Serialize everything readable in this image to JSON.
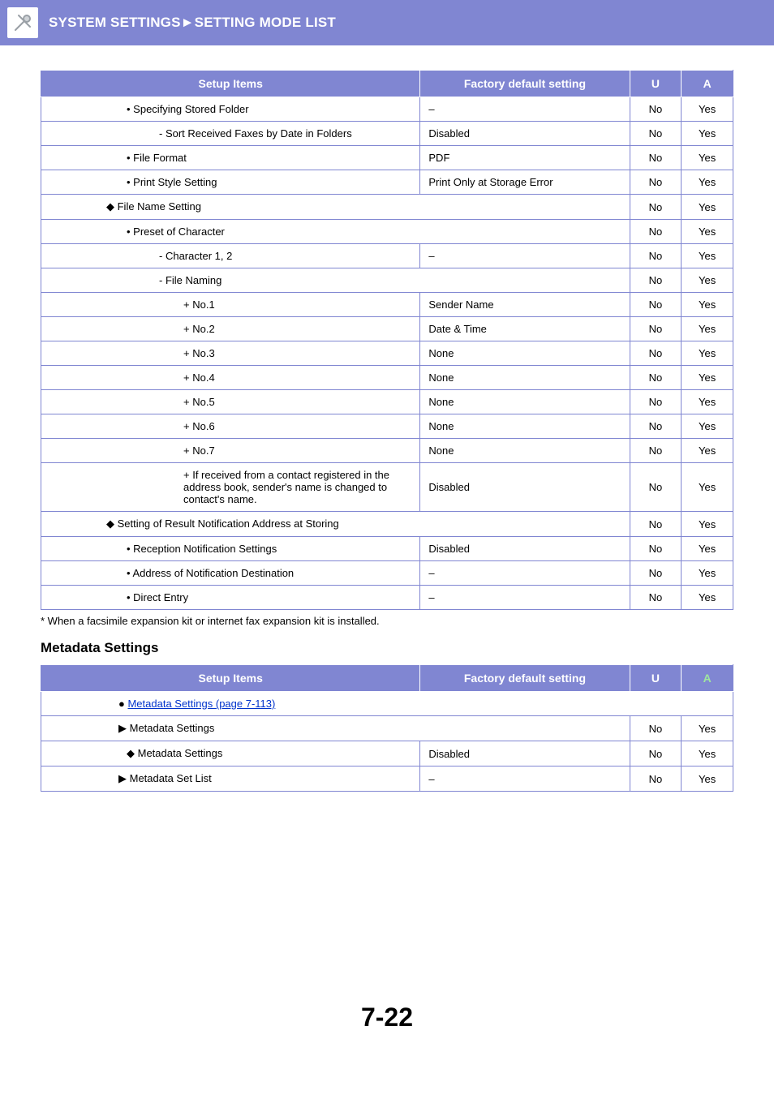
{
  "banner": {
    "title": "SYSTEM SETTINGS►SETTING MODE LIST",
    "icon": "wrench-screwdriver-icon"
  },
  "table1": {
    "headers": {
      "setup": "Setup Items",
      "factory": "Factory default setting",
      "u": "U",
      "a": "A"
    },
    "rows": [
      {
        "ind": "ind-1",
        "b": "•",
        "label": "Specifying Stored Folder",
        "factory": "–",
        "u": "No",
        "a": "Yes",
        "span": false
      },
      {
        "ind": "ind-2",
        "b": "-  ",
        "label": "Sort Received Faxes by Date in Folders",
        "factory": "Disabled",
        "u": "No",
        "a": "Yes",
        "span": false
      },
      {
        "ind": "ind-1",
        "b": "•",
        "label": "File Format",
        "factory": "PDF",
        "u": "No",
        "a": "Yes",
        "span": false
      },
      {
        "ind": "ind-1",
        "b": "•",
        "label": "Print Style Setting",
        "factory": "Print Only at Storage Error",
        "u": "No",
        "a": "Yes",
        "span": false
      },
      {
        "ind": "ind-0d",
        "b": "◆",
        "label": "File Name Setting",
        "factory": "",
        "u": "No",
        "a": "Yes",
        "span": true
      },
      {
        "ind": "ind-1",
        "b": "•",
        "label": "Preset of Character",
        "factory": "",
        "u": "No",
        "a": "Yes",
        "span": true
      },
      {
        "ind": "ind-2",
        "b": "-  ",
        "label": "Character 1, 2",
        "factory": "–",
        "u": "No",
        "a": "Yes",
        "span": false
      },
      {
        "ind": "ind-2",
        "b": "-  ",
        "label": "File Naming",
        "factory": "",
        "u": "No",
        "a": "Yes",
        "span": true
      },
      {
        "ind": "ind-3",
        "b": "+ ",
        "label": "No.1",
        "factory": "Sender Name",
        "u": "No",
        "a": "Yes",
        "span": false
      },
      {
        "ind": "ind-3",
        "b": "+ ",
        "label": "No.2",
        "factory": "Date & Time",
        "u": "No",
        "a": "Yes",
        "span": false
      },
      {
        "ind": "ind-3",
        "b": "+ ",
        "label": "No.3",
        "factory": "None",
        "u": "No",
        "a": "Yes",
        "span": false
      },
      {
        "ind": "ind-3",
        "b": "+ ",
        "label": "No.4",
        "factory": "None",
        "u": "No",
        "a": "Yes",
        "span": false
      },
      {
        "ind": "ind-3",
        "b": "+ ",
        "label": "No.5",
        "factory": "None",
        "u": "No",
        "a": "Yes",
        "span": false
      },
      {
        "ind": "ind-3",
        "b": "+ ",
        "label": "No.6",
        "factory": "None",
        "u": "No",
        "a": "Yes",
        "span": false
      },
      {
        "ind": "ind-3",
        "b": "+ ",
        "label": "No.7",
        "factory": "None",
        "u": "No",
        "a": "Yes",
        "span": false
      },
      {
        "ind": "ind-3",
        "b": "+ ",
        "label": "If received from a contact registered in the address book, sender's name is changed to contact's name.",
        "factory": "Disabled",
        "u": "No",
        "a": "Yes",
        "span": false
      },
      {
        "ind": "ind-0d",
        "b": "◆",
        "label": "Setting of Result Notification Address at Storing",
        "factory": "",
        "u": "No",
        "a": "Yes",
        "span": true
      },
      {
        "ind": "ind-1",
        "b": "•",
        "label": "Reception Notification Settings",
        "factory": "Disabled",
        "u": "No",
        "a": "Yes",
        "span": false
      },
      {
        "ind": "ind-1",
        "b": "•",
        "label": "Address of Notification Destination",
        "factory": "–",
        "u": "No",
        "a": "Yes",
        "span": false
      },
      {
        "ind": "ind-1",
        "b": "•",
        "label": "Direct Entry",
        "factory": "–",
        "u": "No",
        "a": "Yes",
        "span": false
      }
    ]
  },
  "footnote": "*    When a facsimile expansion kit or internet fax expansion kit is installed.",
  "section2_title": "Metadata Settings",
  "table2": {
    "headers": {
      "setup": "Setup Items",
      "factory": "Factory default setting",
      "u": "U",
      "a": "A"
    },
    "rows": [
      {
        "ind": "ind-0b",
        "b": "●",
        "label": "Metadata Settings (page 7-113)",
        "factory": "",
        "u": "",
        "a": "",
        "span": true,
        "link": true,
        "fullspan": true
      },
      {
        "ind": "ind-0b",
        "b": "▶",
        "label": "Metadata Settings",
        "factory": "",
        "u": "No",
        "a": "Yes",
        "span": true
      },
      {
        "ind": "ind-1",
        "b": "◆",
        "label": "Metadata Settings",
        "factory": "Disabled",
        "u": "No",
        "a": "Yes",
        "span": false,
        "pad": "125px"
      },
      {
        "ind": "ind-0b",
        "b": "▶",
        "label": "Metadata Set List",
        "factory": "–",
        "u": "No",
        "a": "Yes",
        "span": false
      }
    ]
  },
  "page_number": "7-22"
}
